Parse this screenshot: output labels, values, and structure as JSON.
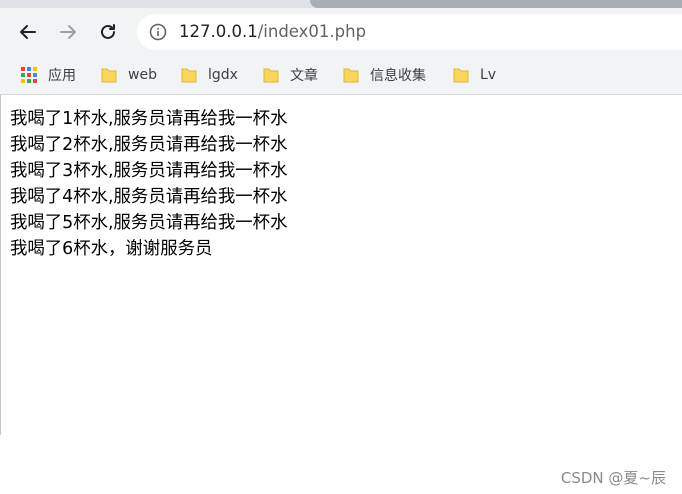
{
  "toolbar": {
    "url_host": "127.0.0.1",
    "url_path": "/index01.php"
  },
  "bookmarks": [
    {
      "label": "应用",
      "icon": "apps-grid-icon"
    },
    {
      "label": "web",
      "icon": "folder-icon"
    },
    {
      "label": "lgdx",
      "icon": "folder-icon"
    },
    {
      "label": "文章",
      "icon": "folder-icon"
    },
    {
      "label": "信息收集",
      "icon": "folder-icon"
    },
    {
      "label": "Lv",
      "icon": "folder-icon"
    }
  ],
  "content": {
    "lines": [
      "我喝了1杯水,服务员请再给我一杯水",
      "我喝了2杯水,服务员请再给我一杯水",
      "我喝了3杯水,服务员请再给我一杯水",
      "我喝了4杯水,服务员请再给我一杯水",
      "我喝了5杯水,服务员请再给我一杯水",
      "我喝了6杯水，谢谢服务员"
    ]
  },
  "watermark": "CSDN @夏~辰",
  "colors": {
    "toolbar_bg": "#f1f3f4",
    "folder_yellow": "#f9d65b",
    "text": "#000000"
  }
}
